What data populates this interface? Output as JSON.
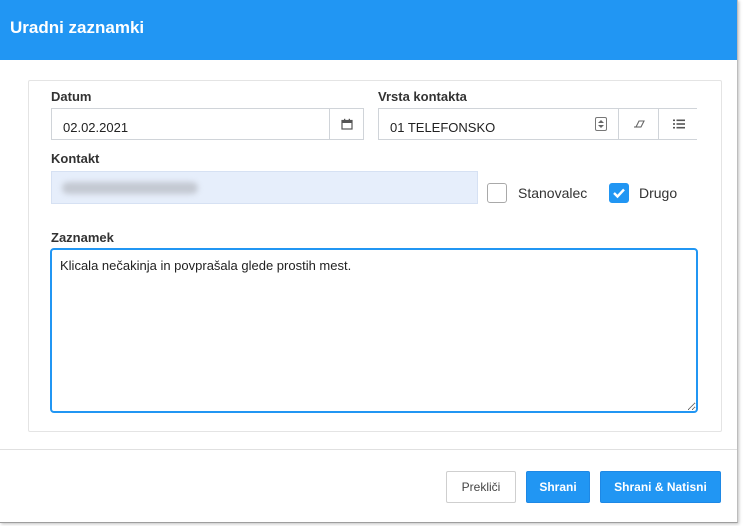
{
  "dialog": {
    "title": "Uradni zaznamki"
  },
  "form": {
    "datum": {
      "label": "Datum",
      "value": "02.02.2021"
    },
    "vrsta_kontakta": {
      "label": "Vrsta kontakta",
      "value": "01 TELEFONSKO"
    },
    "kontakt": {
      "label": "Kontakt",
      "value": ""
    },
    "stanovalec": {
      "label": "Stanovalec",
      "checked": false
    },
    "drugo": {
      "label": "Drugo",
      "checked": true
    },
    "zaznamek": {
      "label": "Zaznamek",
      "value": "Klicala nečakinja in povprašala glede prostih mest."
    }
  },
  "footer": {
    "cancel_label": "Prekliči",
    "save_label": "Shrani",
    "save_print_label": "Shrani & Natisni"
  },
  "colors": {
    "accent": "#2196f3",
    "contact_bg": "#e6eefb"
  }
}
